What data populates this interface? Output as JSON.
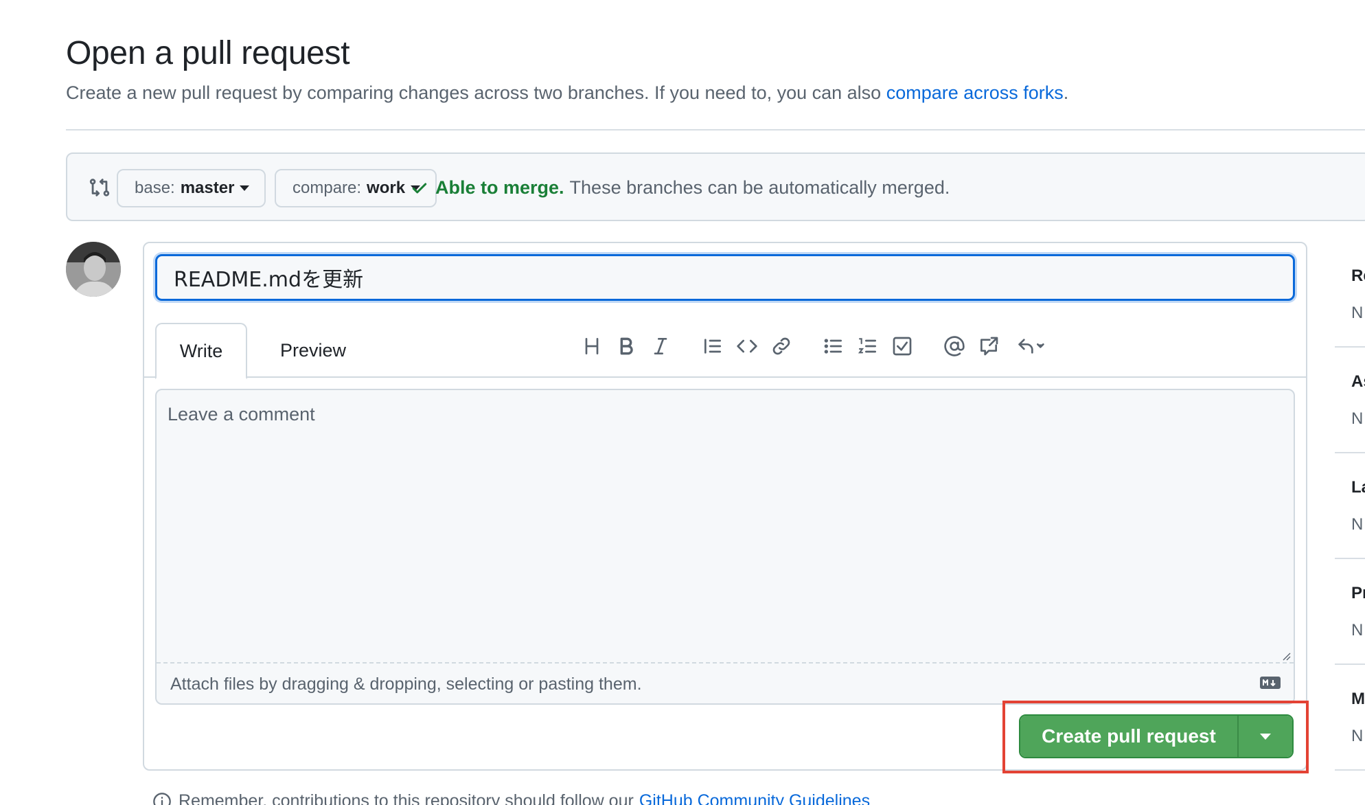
{
  "header": {
    "title": "Open a pull request",
    "subtitle": "Create a new pull request by comparing changes across two branches. If you need to, you can also ",
    "subtitle_link": "compare across forks",
    "subtitle_end": "."
  },
  "compare": {
    "base_label": "base:",
    "base_value": "master",
    "compare_label": "compare:",
    "compare_value": "work",
    "status_ok": "Able to merge.",
    "status_text": "These branches can be automatically merged."
  },
  "form": {
    "title_value": "README.mdを更新",
    "tabs": {
      "write": "Write",
      "preview": "Preview"
    },
    "comment_placeholder": "Leave a comment",
    "attach_text": "Attach files by dragging & dropping, selecting or pasting them.",
    "submit_label": "Create pull request"
  },
  "toolbar": [
    "heading-icon",
    "bold-icon",
    "italic-icon",
    "quote-icon",
    "code-icon",
    "link-icon",
    "unordered-list-icon",
    "ordered-list-icon",
    "task-list-icon",
    "mention-icon",
    "cross-reference-icon",
    "reply-icon"
  ],
  "footer": {
    "text": "Remember, contributions to this repository should follow our",
    "link": "GitHub Community Guidelines"
  },
  "sidebar": [
    {
      "head": "Re",
      "val": "N"
    },
    {
      "head": "As",
      "val": "N"
    },
    {
      "head": "La",
      "val": "N"
    },
    {
      "head": "Pr",
      "val": "N"
    },
    {
      "head": "M",
      "val": "N"
    }
  ],
  "colors": {
    "accent": "#0969da",
    "success": "#1a7f37",
    "button_green": "#4fa55a",
    "highlight": "#e34234"
  }
}
